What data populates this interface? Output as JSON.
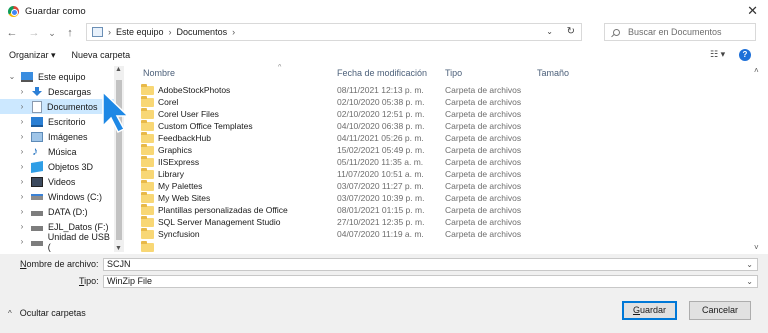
{
  "window": {
    "title": "Guardar como",
    "close_symbol": "✕"
  },
  "nav_buttons": {
    "back": "←",
    "forward": "→",
    "recent": "⌄",
    "up": "↑"
  },
  "address": {
    "separator": "›",
    "segments": [
      "Este equipo",
      "Documentos"
    ],
    "dropdown": "⌄",
    "refresh": "↻"
  },
  "search": {
    "placeholder": "Buscar en Documentos"
  },
  "toolbar": {
    "organize_label": "Organizar ▾",
    "new_folder_label": "Nueva carpeta",
    "view_label": "☷ ▾",
    "help_label": "?"
  },
  "nav_pane": {
    "items": [
      {
        "label": "Este equipo",
        "icon": "pc-icon",
        "expanded": true
      },
      {
        "label": "Descargas",
        "icon": "downloads-icon"
      },
      {
        "label": "Documentos",
        "icon": "documents-icon",
        "selected": true
      },
      {
        "label": "Escritorio",
        "icon": "desktop-icon"
      },
      {
        "label": "Imágenes",
        "icon": "pictures-icon"
      },
      {
        "label": "Música",
        "icon": "music-icon"
      },
      {
        "label": "Objetos 3D",
        "icon": "objects3d-icon"
      },
      {
        "label": "Videos",
        "icon": "videos-icon"
      },
      {
        "label": "Windows (C:)",
        "icon": "windows-drive-icon"
      },
      {
        "label": "DATA (D:)",
        "icon": "drive-icon"
      },
      {
        "label": "EJL_Datos (F:)",
        "icon": "drive-icon"
      },
      {
        "label": "Unidad de USB (",
        "icon": "usb-drive-icon"
      }
    ]
  },
  "columns": {
    "name": "Nombre",
    "modified": "Fecha de modificación",
    "type": "Tipo",
    "size": "Tamaño"
  },
  "files": [
    {
      "name": "AdobeStockPhotos",
      "modified": "08/11/2021 12:13 p. m.",
      "type": "Carpeta de archivos"
    },
    {
      "name": "Corel",
      "modified": "02/10/2020 05:38 p. m.",
      "type": "Carpeta de archivos"
    },
    {
      "name": "Corel User Files",
      "modified": "02/10/2020 12:51 p. m.",
      "type": "Carpeta de archivos"
    },
    {
      "name": "Custom Office Templates",
      "modified": "04/10/2020 06:38 p. m.",
      "type": "Carpeta de archivos"
    },
    {
      "name": "FeedbackHub",
      "modified": "04/11/2021 05:26 p. m.",
      "type": "Carpeta de archivos"
    },
    {
      "name": "Graphics",
      "modified": "15/02/2021 05:49 p. m.",
      "type": "Carpeta de archivos"
    },
    {
      "name": "IISExpress",
      "modified": "05/11/2020 11:35 a. m.",
      "type": "Carpeta de archivos"
    },
    {
      "name": "Library",
      "modified": "11/07/2020 10:51 a. m.",
      "type": "Carpeta de archivos"
    },
    {
      "name": "My Palettes",
      "modified": "03/07/2020 11:27 p. m.",
      "type": "Carpeta de archivos"
    },
    {
      "name": "My Web Sites",
      "modified": "03/07/2020 10:39 p. m.",
      "type": "Carpeta de archivos"
    },
    {
      "name": "Plantillas personalizadas de Office",
      "modified": "08/01/2021 01:15 p. m.",
      "type": "Carpeta de archivos"
    },
    {
      "name": "SQL Server Management Studio",
      "modified": "27/10/2021 12:35 p. m.",
      "type": "Carpeta de archivos"
    },
    {
      "name": "Syncfusion",
      "modified": "04/07/2020 11:19 a. m.",
      "type": "Carpeta de archivos"
    }
  ],
  "filename_field": {
    "label_underlined": "N",
    "label_rest": "ombre de archivo:",
    "value": "SCJN"
  },
  "filetype_field": {
    "label_underlined": "T",
    "label_rest": "ipo:",
    "value": "WinZip File"
  },
  "footer": {
    "hide_folders_caret": "^",
    "hide_folders_label": "Ocultar carpetas",
    "save_underlined": "G",
    "save_rest": "uardar",
    "cancel_label": "Cancelar"
  },
  "colors": {
    "selection": "#cce8ff",
    "accent": "#0078d7",
    "folder": "#f8d775",
    "cursor": "#1e88e5"
  }
}
